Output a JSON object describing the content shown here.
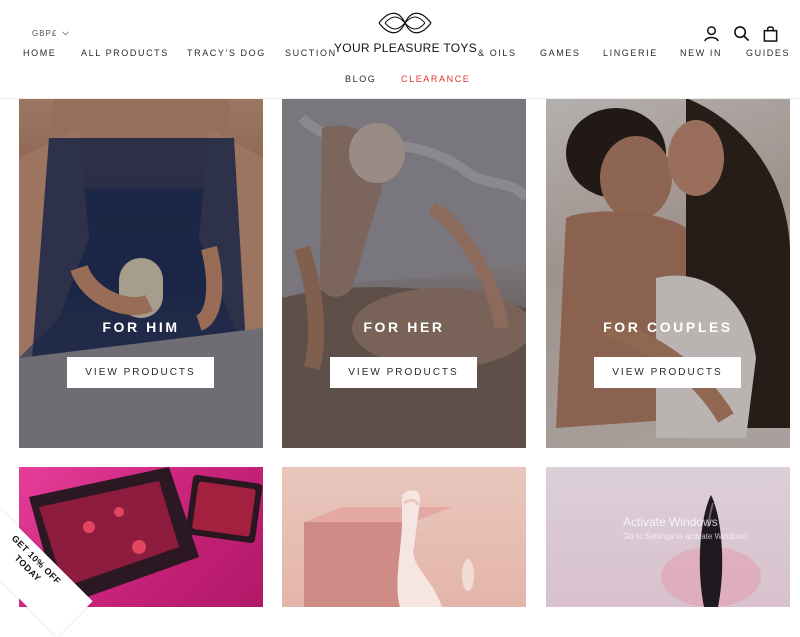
{
  "header": {
    "currency": "GBP£",
    "logo_text": "YOUR PLEASURE TOYS",
    "nav_row1": [
      "HOME",
      "ALL PRODUCTS",
      "TRACY'S DOG",
      "SUCTION",
      "& OILS",
      "GAMES",
      "LINGERIE",
      "NEW IN",
      "GUIDES"
    ],
    "nav_row2": [
      "BLOG",
      "CLEARANCE"
    ],
    "accent_red": "#e2322d"
  },
  "icons": [
    "account-icon",
    "search-icon",
    "cart-icon",
    "chevron-down-icon"
  ],
  "tiles": [
    {
      "title": "FOR HIM",
      "button": "VIEW PRODUCTS"
    },
    {
      "title": "FOR HER",
      "button": "VIEW PRODUCTS"
    },
    {
      "title": "FOR COUPLES",
      "button": "VIEW PRODUCTS"
    }
  ],
  "overlay": {
    "activate_windows": "Activate Windows",
    "activate_sub": "Go to Settings to activate Windows."
  },
  "promo": {
    "line1": "GET 10% OFF",
    "line2": "TODAY"
  }
}
